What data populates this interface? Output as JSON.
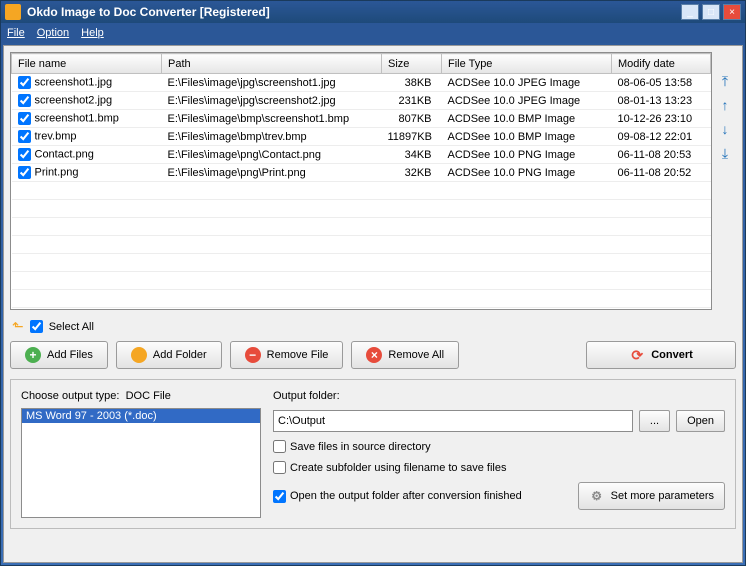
{
  "window": {
    "title": "Okdo Image to Doc Converter [Registered]"
  },
  "menu": {
    "file": "File",
    "option": "Option",
    "help": "Help"
  },
  "columns": {
    "name": "File name",
    "path": "Path",
    "size": "Size",
    "type": "File Type",
    "modify": "Modify date"
  },
  "files": [
    {
      "name": "screenshot1.jpg",
      "path": "E:\\Files\\image\\jpg\\screenshot1.jpg",
      "size": "38KB",
      "type": "ACDSee 10.0 JPEG Image",
      "modify": "08-06-05 13:58"
    },
    {
      "name": "screenshot2.jpg",
      "path": "E:\\Files\\image\\jpg\\screenshot2.jpg",
      "size": "231KB",
      "type": "ACDSee 10.0 JPEG Image",
      "modify": "08-01-13 13:23"
    },
    {
      "name": "screenshot1.bmp",
      "path": "E:\\Files\\image\\bmp\\screenshot1.bmp",
      "size": "807KB",
      "type": "ACDSee 10.0 BMP Image",
      "modify": "10-12-26 23:10"
    },
    {
      "name": "trev.bmp",
      "path": "E:\\Files\\image\\bmp\\trev.bmp",
      "size": "11897KB",
      "type": "ACDSee 10.0 BMP Image",
      "modify": "09-08-12 22:01"
    },
    {
      "name": "Contact.png",
      "path": "E:\\Files\\image\\png\\Contact.png",
      "size": "34KB",
      "type": "ACDSee 10.0 PNG Image",
      "modify": "06-11-08 20:53"
    },
    {
      "name": "Print.png",
      "path": "E:\\Files\\image\\png\\Print.png",
      "size": "32KB",
      "type": "ACDSee 10.0 PNG Image",
      "modify": "06-11-08 20:52"
    }
  ],
  "selectall": "Select All",
  "buttons": {
    "addfiles": "Add Files",
    "addfolder": "Add Folder",
    "removefile": "Remove File",
    "removeall": "Remove All",
    "convert": "Convert",
    "setparams": "Set more parameters"
  },
  "outputtype": {
    "label": "Choose output type:",
    "value": "DOC File",
    "option": "MS Word 97 - 2003 (*.doc)"
  },
  "outputfolder": {
    "label": "Output folder:",
    "value": "C:\\Output",
    "browse": "...",
    "open": "Open"
  },
  "options": {
    "saveinsource": "Save files in source directory",
    "createsub": "Create subfolder using filename to save files",
    "openafter": "Open the output folder after conversion finished"
  }
}
